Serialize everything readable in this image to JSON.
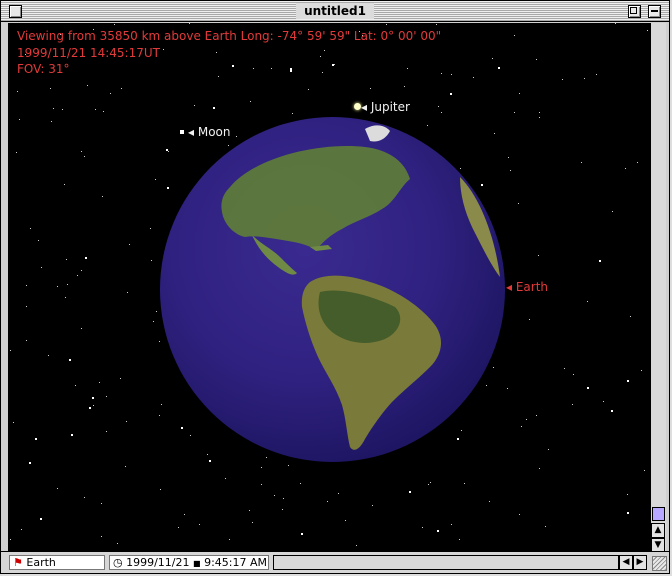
{
  "window": {
    "title": "untitled1"
  },
  "viewport": {
    "hud": {
      "line1": "Viewing from 35850 km above Earth   Long: -74° 59' 59\" Lat: 0° 00' 00\"",
      "line2": "1999/11/21 14:45:17UT",
      "line3": "FOV: 31°"
    },
    "labels": {
      "jupiter": "◂ Jupiter",
      "moon": "◂ Moon",
      "earth": "◂ Earth"
    },
    "colors": {
      "hud_text": "#e23a3a",
      "space": "#000000",
      "globe": "#2f2180"
    }
  },
  "statusbar": {
    "body": "Earth",
    "date": "1999/11/21",
    "time": "9:45:17 AM"
  },
  "icons": {
    "flag": "flag-icon",
    "clock": "clock-icon",
    "play": "play-icon"
  }
}
